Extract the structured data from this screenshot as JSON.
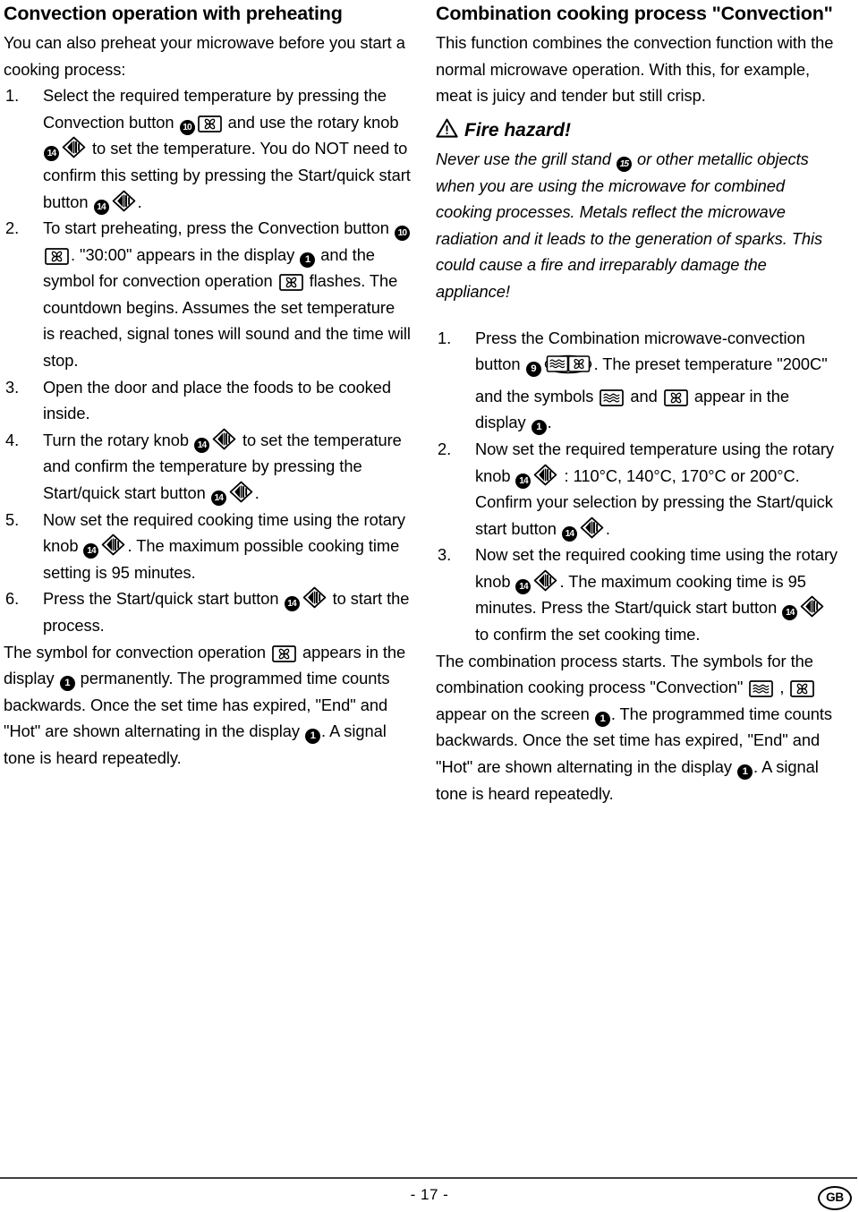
{
  "document": {
    "page_number": "- 17 -",
    "language_badge": "GB"
  },
  "left_column": {
    "title": "Convection operation with preheating",
    "intro": "You can also preheat your microwave before you start a cooking process:",
    "steps": [
      {
        "num": "1.",
        "parts": [
          {
            "t": "text",
            "v": "Select the required temperature by pressing the Convection button "
          },
          {
            "t": "ref",
            "v": "10"
          },
          {
            "t": "icon",
            "v": "convection-fan-icon"
          },
          {
            "t": "text",
            "v": " and use the rotary knob "
          },
          {
            "t": "ref",
            "v": "14"
          },
          {
            "t": "icon",
            "v": "rotary-knob-icon"
          },
          {
            "t": "text",
            "v": " to set the temperature. You do NOT need to confirm this setting by pressing the Start/quick start button "
          },
          {
            "t": "ref",
            "v": "14"
          },
          {
            "t": "icon",
            "v": "rotary-knob-icon"
          },
          {
            "t": "text",
            "v": "."
          }
        ]
      },
      {
        "num": "2.",
        "parts": [
          {
            "t": "text",
            "v": "To start preheating, press the Convection button "
          },
          {
            "t": "ref",
            "v": "10"
          },
          {
            "t": "icon",
            "v": "convection-fan-icon"
          },
          {
            "t": "text",
            "v": ". \"30:00\" appears in the display "
          },
          {
            "t": "ref",
            "v": "1"
          },
          {
            "t": "text",
            "v": " and the symbol for convection operation "
          },
          {
            "t": "icon",
            "v": "convection-fan-icon"
          },
          {
            "t": "text",
            "v": " flashes. The countdown begins. Assumes the set temperature is reached, signal tones will sound and the time will stop."
          }
        ]
      },
      {
        "num": "3.",
        "parts": [
          {
            "t": "text",
            "v": "Open the door and place the foods to be cooked inside."
          }
        ]
      },
      {
        "num": "4.",
        "parts": [
          {
            "t": "text",
            "v": "Turn the rotary knob "
          },
          {
            "t": "ref",
            "v": "14"
          },
          {
            "t": "icon",
            "v": "rotary-knob-icon"
          },
          {
            "t": "text",
            "v": " to set the temperature and confirm the temperature by pressing the Start/quick start button "
          },
          {
            "t": "ref",
            "v": "14"
          },
          {
            "t": "icon",
            "v": "rotary-knob-icon"
          },
          {
            "t": "text",
            "v": "."
          }
        ]
      },
      {
        "num": "5.",
        "parts": [
          {
            "t": "text",
            "v": "Now set the required cooking time using the rotary knob "
          },
          {
            "t": "ref",
            "v": "14"
          },
          {
            "t": "icon",
            "v": "rotary-knob-icon"
          },
          {
            "t": "text",
            "v": ". The maximum possible cooking time setting is 95 minutes."
          }
        ]
      },
      {
        "num": "6.",
        "parts": [
          {
            "t": "text",
            "v": "Press the Start/quick start button "
          },
          {
            "t": "ref",
            "v": "14"
          },
          {
            "t": "icon",
            "v": "rotary-knob-icon"
          },
          {
            "t": "text",
            "v": " to start the process."
          }
        ]
      }
    ],
    "closing_parts": [
      {
        "t": "text",
        "v": "The symbol for convection operation "
      },
      {
        "t": "icon",
        "v": "convection-fan-icon"
      },
      {
        "t": "text",
        "v": " appears in the display "
      },
      {
        "t": "ref",
        "v": "1"
      },
      {
        "t": "text",
        "v": " permanently. The programmed time counts backwards. Once the set time has expired, \"End\" and \"Hot\" are shown alternating in the display "
      },
      {
        "t": "ref",
        "v": "1"
      },
      {
        "t": "text",
        "v": ". A signal tone is heard repeatedly."
      }
    ]
  },
  "right_column": {
    "title": "Combination cooking process \"Convection\"",
    "intro": "This function combines the convection function with the normal microwave operation. With this, for example, meat is juicy and tender but still crisp.",
    "warning": {
      "icon": "warning-triangle-icon",
      "heading": "Fire hazard!",
      "body_parts": [
        {
          "t": "text",
          "v": "Never use the grill stand "
        },
        {
          "t": "ref",
          "v": "15"
        },
        {
          "t": "text",
          "v": " or other metallic objects when you are using the microwave for combined cooking processes. Metals reflect the microwave radiation and it leads to the generation of sparks. This could cause a fire and irreparably damage the appliance!"
        }
      ]
    },
    "steps": [
      {
        "num": "1.",
        "parts": [
          {
            "t": "text",
            "v": "Press the Combination microwave-convection button "
          },
          {
            "t": "ref",
            "v": "9"
          },
          {
            "t": "icon",
            "v": "combination-microwave-convection-icon"
          },
          {
            "t": "text",
            "v": ". The preset temperature \"200C\" and the symbols "
          },
          {
            "t": "icon",
            "v": "microwave-waves-icon"
          },
          {
            "t": "text",
            "v": " and "
          },
          {
            "t": "icon",
            "v": "convection-fan-icon"
          },
          {
            "t": "text",
            "v": " appear in the display "
          },
          {
            "t": "ref",
            "v": "1"
          },
          {
            "t": "text",
            "v": "."
          }
        ]
      },
      {
        "num": "2.",
        "parts": [
          {
            "t": "text",
            "v": "Now set the required temperature using the rotary knob "
          },
          {
            "t": "ref",
            "v": "14"
          },
          {
            "t": "icon",
            "v": "rotary-knob-icon"
          },
          {
            "t": "text",
            "v": " : 110°C, 140°C, 170°C or 200°C. Confirm your selection by pressing the Start/quick start button "
          },
          {
            "t": "ref",
            "v": "14"
          },
          {
            "t": "icon",
            "v": "rotary-knob-icon"
          },
          {
            "t": "text",
            "v": "."
          }
        ]
      },
      {
        "num": "3.",
        "parts": [
          {
            "t": "text",
            "v": "Now set the required cooking time using the rotary knob "
          },
          {
            "t": "ref",
            "v": "14"
          },
          {
            "t": "icon",
            "v": "rotary-knob-icon"
          },
          {
            "t": "text",
            "v": ". The maximum cooking time is 95 minutes. Press the Start/quick start button "
          },
          {
            "t": "ref",
            "v": "14"
          },
          {
            "t": "icon",
            "v": "rotary-knob-icon"
          },
          {
            "t": "text",
            "v": " to confirm the set cooking time."
          }
        ]
      }
    ],
    "closing_parts": [
      {
        "t": "text",
        "v": "The combination process starts. The symbols for the combination cooking process \"Convection\" "
      },
      {
        "t": "icon",
        "v": "microwave-waves-icon"
      },
      {
        "t": "text",
        "v": " , "
      },
      {
        "t": "icon",
        "v": "convection-fan-icon"
      },
      {
        "t": "text",
        "v": " appear on the screen "
      },
      {
        "t": "ref",
        "v": "1"
      },
      {
        "t": "text",
        "v": ". The programmed time counts backwards. Once the set time has expired, \"End\" and \"Hot\" are shown alternating in the display "
      },
      {
        "t": "ref",
        "v": "1"
      },
      {
        "t": "text",
        "v": ". A signal tone is heard repeatedly."
      }
    ]
  },
  "colors": {
    "text": "#000000",
    "background": "#ffffff",
    "rule": "#404040"
  }
}
